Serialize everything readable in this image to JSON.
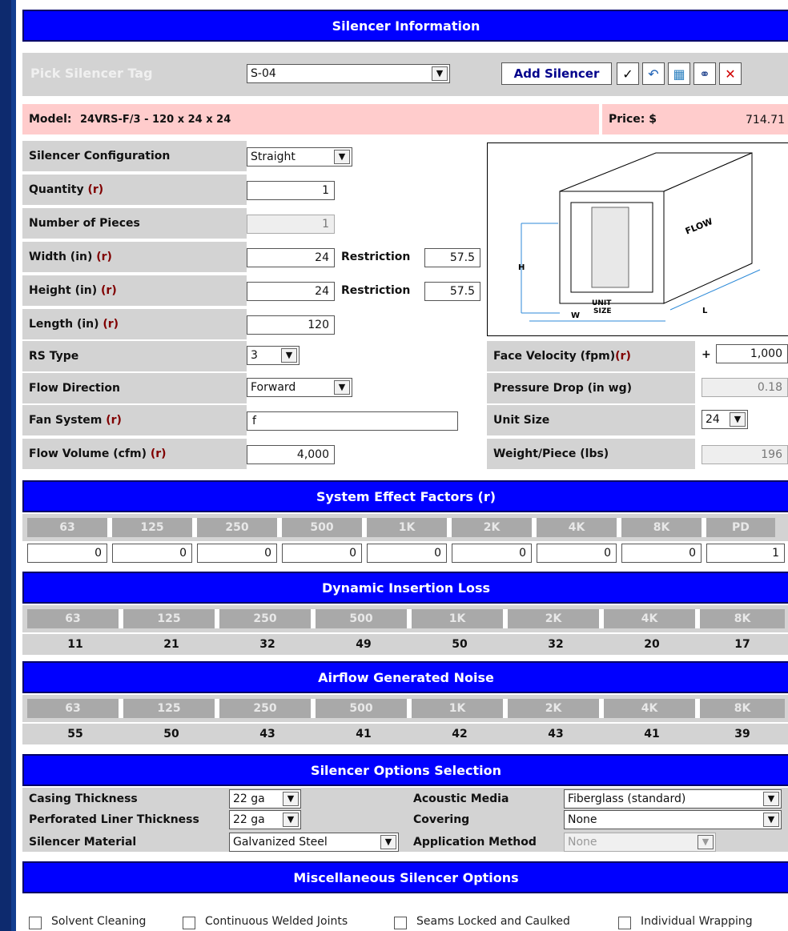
{
  "header": {
    "title": "Silencer Information"
  },
  "tag": {
    "label": "Pick Silencer Tag",
    "value": "S-04",
    "add_label": "Add Silencer"
  },
  "model": {
    "label": "Model:",
    "value": "24VRS-F/3 - 120 x 24 x 24",
    "price_label": "Price: $",
    "price": "714.71"
  },
  "form": {
    "config": {
      "label": "Silencer Configuration",
      "value": "Straight"
    },
    "quantity": {
      "label": "Quantity",
      "r": "(r)",
      "value": "1"
    },
    "pieces": {
      "label": "Number of Pieces",
      "value": "1"
    },
    "width": {
      "label": "Width (in)",
      "r": "(r)",
      "value": "24",
      "restriction_label": "Restriction",
      "restriction": "57.5"
    },
    "height": {
      "label": "Height (in)",
      "r": "(r)",
      "value": "24",
      "restriction_label": "Restriction",
      "restriction": "57.5"
    },
    "length": {
      "label": "Length (in)",
      "r": "(r)",
      "value": "120"
    },
    "rs_type": {
      "label": "RS Type",
      "value": "3"
    },
    "flow_direction": {
      "label": "Flow Direction",
      "value": "Forward"
    },
    "fan_system": {
      "label": "Fan System",
      "r": "(r)",
      "value": "f"
    },
    "flow_volume": {
      "label": "Flow Volume (cfm)",
      "r": "(r)",
      "value": "4,000"
    },
    "face_velocity": {
      "label": "Face Velocity (fpm)",
      "r": "(r)",
      "plus": "+",
      "value": "1,000"
    },
    "pressure_drop": {
      "label": "Pressure Drop (in wg)",
      "value": "0.18"
    },
    "unit_size": {
      "label": "Unit Size",
      "value": "24"
    },
    "weight": {
      "label": "Weight/Piece (lbs)",
      "value": "196"
    }
  },
  "diagram": {
    "flow": "FLOW",
    "h": "H",
    "l": "L",
    "unit": "UNIT",
    "size": "SIZE",
    "w": "W"
  },
  "sef": {
    "title": "System Effect Factors (r)",
    "bands": [
      "63",
      "125",
      "250",
      "500",
      "1K",
      "2K",
      "4K",
      "8K",
      "PD"
    ],
    "values": [
      "0",
      "0",
      "0",
      "0",
      "0",
      "0",
      "0",
      "0",
      "1"
    ]
  },
  "dil": {
    "title": "Dynamic Insertion Loss",
    "bands": [
      "63",
      "125",
      "250",
      "500",
      "1K",
      "2K",
      "4K",
      "8K"
    ],
    "values": [
      "11",
      "21",
      "32",
      "49",
      "50",
      "32",
      "20",
      "17"
    ]
  },
  "agn": {
    "title": "Airflow Generated Noise",
    "bands": [
      "63",
      "125",
      "250",
      "500",
      "1K",
      "2K",
      "4K",
      "8K"
    ],
    "values": [
      "55",
      "50",
      "43",
      "41",
      "42",
      "43",
      "41",
      "39"
    ]
  },
  "options": {
    "title": "Silencer Options Selection",
    "casing": {
      "label": "Casing Thickness",
      "value": "22 ga"
    },
    "liner": {
      "label": "Perforated Liner Thickness",
      "value": "22 ga"
    },
    "material": {
      "label": "Silencer Material",
      "value": "Galvanized Steel"
    },
    "media": {
      "label": "Acoustic Media",
      "value": "Fiberglass (standard)"
    },
    "covering": {
      "label": "Covering",
      "value": "None"
    },
    "method": {
      "label": "Application Method",
      "value": "None"
    }
  },
  "misc": {
    "title": "Miscellaneous Silencer Options",
    "items": [
      "Solvent Cleaning",
      "Continuous Welded Joints",
      "Seams Locked and Caulked",
      "Individual Wrapping"
    ]
  },
  "colors": {
    "header_blue": "#0000ff",
    "pink": "#ffcccc",
    "gray": "#d3d3d3",
    "dark_gray": "#a9a9a9",
    "r_marker": "#800000"
  }
}
